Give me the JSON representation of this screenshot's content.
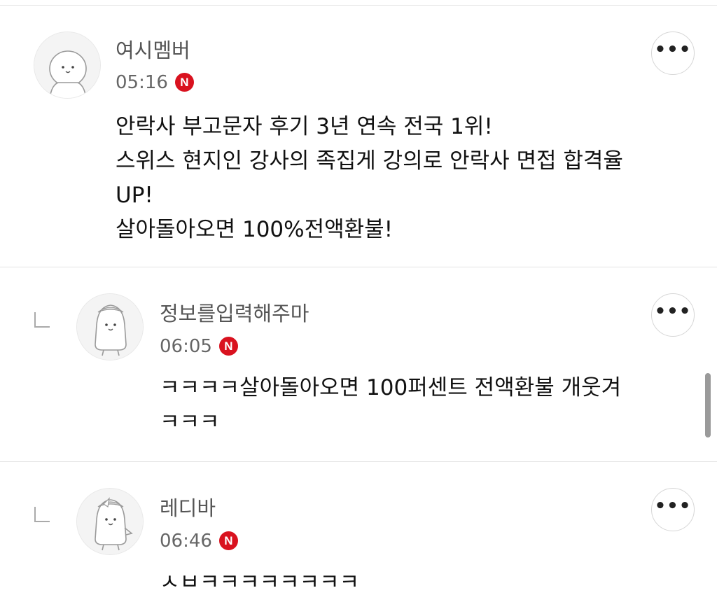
{
  "comments": [
    {
      "author": "여시멤버",
      "time": "05:16",
      "badge": "N",
      "more": "•••",
      "avatar_icon": "cat-avatar-icon",
      "lines": [
        "안락사 부고문자 후기 3년 연속 전국 1위!",
        "스위스 현지인 강사의 족집게 강의로 안락사 면접 합격율",
        "UP!",
        "살아돌아오면 100%전액환불!"
      ]
    },
    {
      "author": "정보를입력해주마",
      "time": "06:05",
      "badge": "N",
      "more": "•••",
      "avatar_icon": "penguin-avatar-icon",
      "lines": [
        "ㅋㅋㅋㅋ살아돌아오면 100퍼센트 전액환불 개웃겨",
        "ㅋㅋㅋ"
      ]
    },
    {
      "author": "레디바",
      "time": "06:46",
      "badge": "N",
      "more": "•••",
      "avatar_icon": "penguin-avatar-icon",
      "lines": [
        "ㅅㅂㅋㅋㅋㅋㅋㅋㅋㅋ"
      ]
    }
  ],
  "colors": {
    "badge": "#d9121f",
    "divider": "#e4e4e4",
    "meta_text": "#666666"
  }
}
